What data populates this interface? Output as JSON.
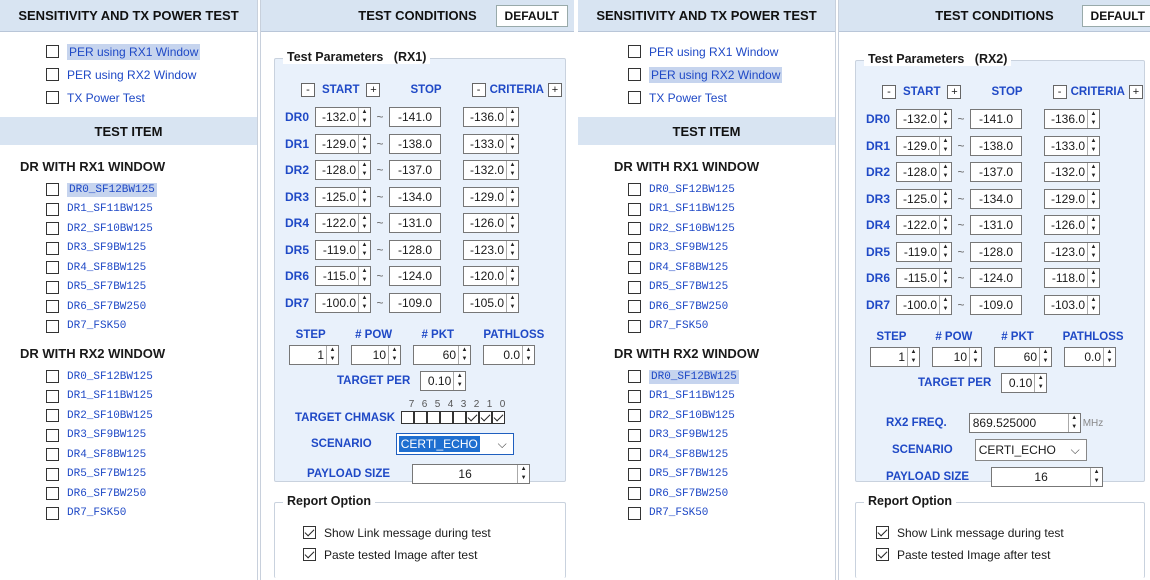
{
  "left_header": "SENSITIVITY AND TX POWER TEST",
  "test_item_header": "TEST ITEM",
  "cond_header": "TEST CONDITIONS",
  "default_btn": "DEFAULT",
  "test_types": [
    "PER using RX1 Window",
    "PER using RX2 Window",
    "TX Power Test"
  ],
  "rx1_group": "DR WITH RX1 WINDOW",
  "rx2_group": "DR WITH RX2 WINDOW",
  "dr_items_rx1": [
    "DR0_SF12BW125",
    "DR1_SF11BW125",
    "DR2_SF10BW125",
    "DR3_SF9BW125",
    "DR4_SF8BW125",
    "DR5_SF7BW125",
    "DR6_SF7BW250",
    "DR7_FSK50"
  ],
  "dr_items_rx2": [
    "DR0_SF12BW125",
    "DR1_SF11BW125",
    "DR2_SF10BW125",
    "DR3_SF9BW125",
    "DR4_SF8BW125",
    "DR5_SF7BW125",
    "DR6_SF7BW250",
    "DR7_FSK50"
  ],
  "panel1": {
    "title": "Test Parameters",
    "window": "(RX1)",
    "cols": {
      "minus": "-",
      "start": "START",
      "plus": "+",
      "stop": "STOP",
      "criteria": "CRITERIA"
    },
    "dr_labels": [
      "DR0",
      "DR1",
      "DR2",
      "DR3",
      "DR4",
      "DR5",
      "DR6",
      "DR7"
    ],
    "tilde": "~",
    "start": [
      "-132.0",
      "-129.0",
      "-128.0",
      "-125.0",
      "-122.0",
      "-119.0",
      "-115.0",
      "-100.0"
    ],
    "stop": [
      "-141.0",
      "-138.0",
      "-137.0",
      "-134.0",
      "-131.0",
      "-128.0",
      "-124.0",
      "-109.0"
    ],
    "criteria": [
      "-136.0",
      "-133.0",
      "-132.0",
      "-129.0",
      "-126.0",
      "-123.0",
      "-120.0",
      "-105.0"
    ],
    "step_label": "STEP",
    "pow_label": "# POW",
    "pkt_label": "# PKT",
    "pathloss_label": "PATHLOSS",
    "step": "1",
    "pow": "10",
    "pkt": "60",
    "pathloss": "0.0",
    "target_per_label": "TARGET PER",
    "target_per": "0.10",
    "chmask_label": "TARGET CHMASK",
    "chmask_bits": [
      "7",
      "6",
      "5",
      "4",
      "3",
      "2",
      "1",
      "0"
    ],
    "chmask_checked": [
      false,
      false,
      false,
      false,
      false,
      true,
      true,
      true
    ],
    "scenario_label": "SCENARIO",
    "scenario": "CERTI_ECHO",
    "payload_label": "PAYLOAD SIZE",
    "payload": "16"
  },
  "panel2": {
    "title": "Test Parameters",
    "window": "(RX2)",
    "cols": {
      "minus": "-",
      "start": "START",
      "plus": "+",
      "stop": "STOP",
      "criteria": "CRITERIA"
    },
    "dr_labels": [
      "DR0",
      "DR1",
      "DR2",
      "DR3",
      "DR4",
      "DR5",
      "DR6",
      "DR7"
    ],
    "tilde": "~",
    "start": [
      "-132.0",
      "-129.0",
      "-128.0",
      "-125.0",
      "-122.0",
      "-119.0",
      "-115.0",
      "-100.0"
    ],
    "stop": [
      "-141.0",
      "-138.0",
      "-137.0",
      "-134.0",
      "-131.0",
      "-128.0",
      "-124.0",
      "-109.0"
    ],
    "criteria": [
      "-136.0",
      "-133.0",
      "-132.0",
      "-129.0",
      "-126.0",
      "-123.0",
      "-118.0",
      "-103.0"
    ],
    "step_label": "STEP",
    "pow_label": "# POW",
    "pkt_label": "# PKT",
    "pathloss_label": "PATHLOSS",
    "step": "1",
    "pow": "10",
    "pkt": "60",
    "pathloss": "0.0",
    "target_per_label": "TARGET PER",
    "target_per": "0.10",
    "freq_label": "RX2 FREQ.",
    "freq": "869.525000",
    "freq_unit": "MHz",
    "scenario_label": "SCENARIO",
    "scenario": "CERTI_ECHO",
    "payload_label": "PAYLOAD SIZE",
    "payload": "16"
  },
  "report": {
    "title": "Report Option",
    "opt1": "Show Link message during test",
    "opt2": "Paste tested Image after test"
  },
  "colors": {
    "header_bg": "#d8e4f2",
    "link": "#1f49c6",
    "selection": "#c6d4ee",
    "panel_bg": "#e9f1fb"
  }
}
